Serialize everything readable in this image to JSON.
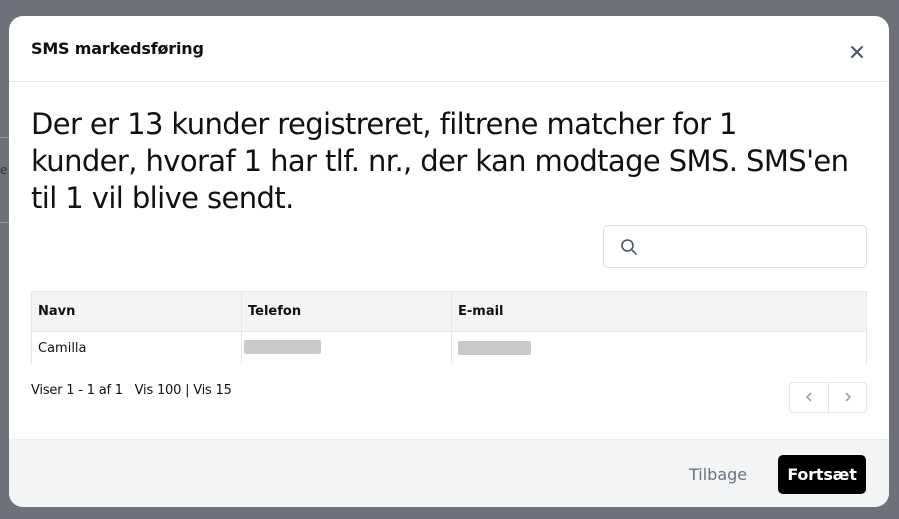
{
  "modal": {
    "title": "SMS markedsføring",
    "headline": "Der er 13 kunder registreret, filtrene matcher for 1 kunder, hvoraf 1 har tlf. nr., der kan modtage SMS. SMS'en til 1 vil blive sendt."
  },
  "search": {
    "placeholder": "",
    "value": "",
    "icon": "search-icon"
  },
  "table": {
    "columns": [
      "Navn",
      "Telefon",
      "E-mail"
    ],
    "rows": [
      {
        "name": "Camilla",
        "phone": "",
        "email": ""
      }
    ]
  },
  "pager": {
    "info": "Viser 1 - 1 af 1   Vis 100 | Vis 15",
    "prev_icon": "chevron-left-icon",
    "next_icon": "chevron-right-icon"
  },
  "footer": {
    "back_label": "Tilbage",
    "continue_label": "Fortsæt"
  },
  "colors": {
    "primary_button": "#000000",
    "backdrop": "#6e7179",
    "header_row": "#f3f4f6"
  }
}
